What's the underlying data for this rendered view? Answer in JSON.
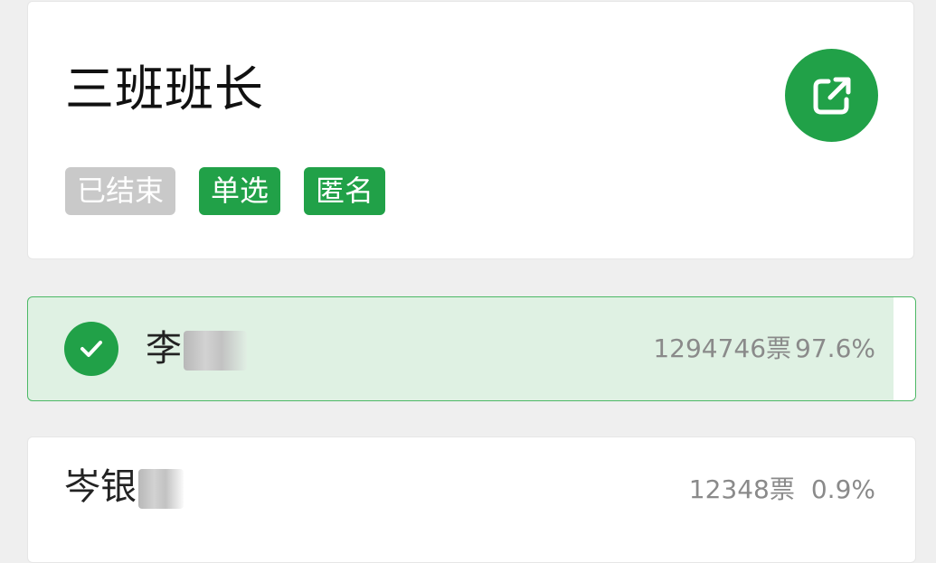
{
  "poll": {
    "title": "三班班长",
    "tags": [
      {
        "label": "已结束",
        "style": "gray"
      },
      {
        "label": "单选",
        "style": "green"
      },
      {
        "label": "匿名",
        "style": "green"
      }
    ]
  },
  "options": [
    {
      "name": "李",
      "votes": "1294746票",
      "percent": "97.6%",
      "percent_value": 97.6,
      "selected": true
    },
    {
      "name": "岑银",
      "votes": "12348票",
      "percent": "0.9%",
      "percent_value": 0.9,
      "selected": false
    }
  ],
  "colors": {
    "accent": "#21a148",
    "selected_bg": "#dff1e3",
    "tag_gray": "#c9c9c9"
  },
  "icons": {
    "share": "external-link-icon",
    "check": "checkmark-icon"
  }
}
